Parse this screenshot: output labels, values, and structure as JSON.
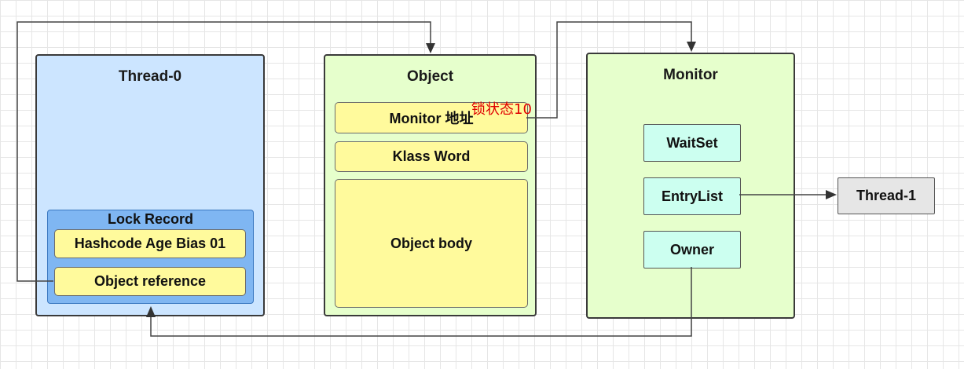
{
  "thread0": {
    "title": "Thread-0",
    "lock_record": {
      "title": "Lock Record",
      "hashcode": "Hashcode Age Bias 01",
      "object_reference": "Object reference"
    }
  },
  "object": {
    "title": "Object",
    "monitor_address": "Monitor 地址",
    "klass_word": "Klass Word",
    "object_body": "Object body"
  },
  "monitor": {
    "title": "Monitor",
    "waitset": "WaitSet",
    "entrylist": "EntryList",
    "owner": "Owner"
  },
  "thread1": {
    "title": "Thread-1"
  },
  "annotation": "锁状态10",
  "colors": {
    "thread0_bg": "#cce5ff",
    "object_bg": "#e6ffcc",
    "monitor_bg": "#e6ffcc",
    "lock_record_bg": "#7fb6f2",
    "yellow_cell": "#fffa9c",
    "cyan_cell": "#ccfff0",
    "thread1_bg": "#e6e6e6",
    "annotation": "#e00000"
  }
}
